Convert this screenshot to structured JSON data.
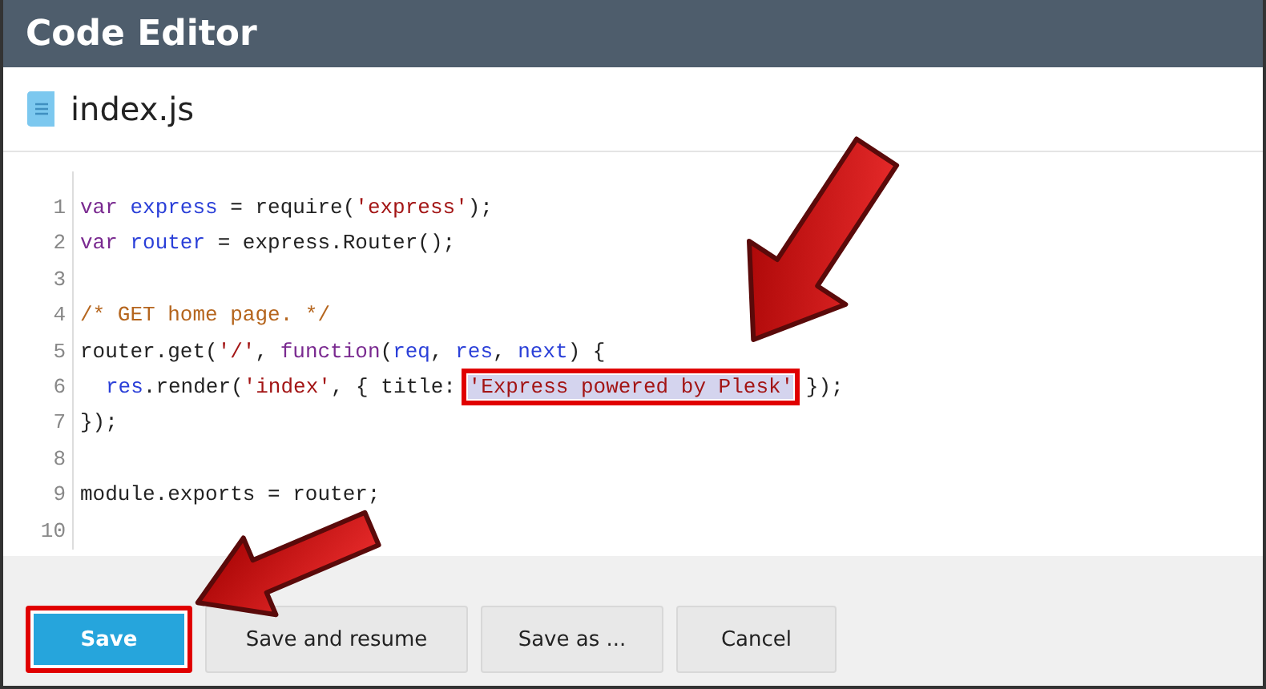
{
  "window": {
    "title": "Code Editor"
  },
  "file": {
    "name": "index.js"
  },
  "code": {
    "lines": [
      {
        "number": "1",
        "indented": false,
        "tokens": [
          {
            "kind": "keyword",
            "text": "var "
          },
          {
            "kind": "variable",
            "text": "express"
          },
          {
            "kind": "plain",
            "text": " = require("
          },
          {
            "kind": "string",
            "text": "'express'"
          },
          {
            "kind": "plain",
            "text": ");"
          }
        ]
      },
      {
        "number": "2",
        "indented": false,
        "tokens": [
          {
            "kind": "keyword",
            "text": "var "
          },
          {
            "kind": "variable",
            "text": "router"
          },
          {
            "kind": "plain",
            "text": " = express.Router();"
          }
        ]
      },
      {
        "number": "3"
      },
      {
        "number": "4",
        "indented": false,
        "tokens": [
          {
            "kind": "comment",
            "text": "/* GET home page. */"
          }
        ]
      },
      {
        "number": "5",
        "indented": false,
        "tokens": [
          {
            "kind": "plain",
            "text": "router.get("
          },
          {
            "kind": "string",
            "text": "'/'"
          },
          {
            "kind": "plain",
            "text": ", "
          },
          {
            "kind": "keyword",
            "text": "function"
          },
          {
            "kind": "plain",
            "text": "("
          },
          {
            "kind": "variable",
            "text": "req"
          },
          {
            "kind": "plain",
            "text": ", "
          },
          {
            "kind": "variable",
            "text": "res"
          },
          {
            "kind": "plain",
            "text": ", "
          },
          {
            "kind": "variable",
            "text": "next"
          },
          {
            "kind": "plain",
            "text": ") {"
          }
        ]
      },
      {
        "number": "6",
        "indented": true,
        "tokens": [
          {
            "kind": "variable",
            "text": "res"
          },
          {
            "kind": "plain",
            "text": ".render("
          },
          {
            "kind": "string",
            "text": "'index'"
          },
          {
            "kind": "plain",
            "text": ", { title: "
          },
          {
            "kind": "string",
            "text": "'Express powered by Plesk'",
            "highlighted": true
          },
          {
            "kind": "plain",
            "text": " });"
          }
        ]
      },
      {
        "number": "7",
        "indented": false,
        "tokens": [
          {
            "kind": "plain",
            "text": "});"
          }
        ]
      },
      {
        "number": "8"
      },
      {
        "number": "9",
        "indented": false,
        "tokens": [
          {
            "kind": "plain",
            "text": "module.exports = router;"
          }
        ]
      },
      {
        "number": "10"
      }
    ]
  },
  "buttons": [
    {
      "label": "Save",
      "kind": "primary",
      "marked": true
    },
    {
      "label": "Save and resume",
      "kind": "secondary",
      "marked": false
    },
    {
      "label": "Save as ...",
      "kind": "secondary",
      "marked": false
    },
    {
      "label": "Cancel",
      "kind": "secondary",
      "marked": false
    }
  ]
}
